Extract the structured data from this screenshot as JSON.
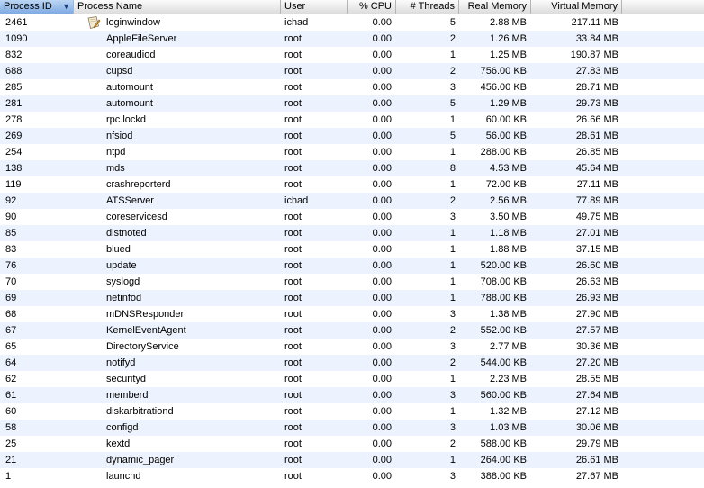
{
  "columns": {
    "pid": "Process ID",
    "name": "Process Name",
    "user": "User",
    "cpu": "% CPU",
    "threads": "# Threads",
    "real": "Real Memory",
    "virtual": "Virtual Memory"
  },
  "sort": {
    "column": "pid",
    "direction": "descending"
  },
  "rows": [
    {
      "pid": "2461",
      "name": "loginwindow",
      "user": "ichad",
      "cpu": "0.00",
      "threads": "5",
      "real": "2.88 MB",
      "virtual": "217.11 MB",
      "icon": "loginwindow-app-icon"
    },
    {
      "pid": "1090",
      "name": "AppleFileServer",
      "user": "root",
      "cpu": "0.00",
      "threads": "2",
      "real": "1.26 MB",
      "virtual": "33.84 MB"
    },
    {
      "pid": "832",
      "name": "coreaudiod",
      "user": "root",
      "cpu": "0.00",
      "threads": "1",
      "real": "1.25 MB",
      "virtual": "190.87 MB"
    },
    {
      "pid": "688",
      "name": "cupsd",
      "user": "root",
      "cpu": "0.00",
      "threads": "2",
      "real": "756.00 KB",
      "virtual": "27.83 MB"
    },
    {
      "pid": "285",
      "name": "automount",
      "user": "root",
      "cpu": "0.00",
      "threads": "3",
      "real": "456.00 KB",
      "virtual": "28.71 MB"
    },
    {
      "pid": "281",
      "name": "automount",
      "user": "root",
      "cpu": "0.00",
      "threads": "5",
      "real": "1.29 MB",
      "virtual": "29.73 MB"
    },
    {
      "pid": "278",
      "name": "rpc.lockd",
      "user": "root",
      "cpu": "0.00",
      "threads": "1",
      "real": "60.00 KB",
      "virtual": "26.66 MB"
    },
    {
      "pid": "269",
      "name": "nfsiod",
      "user": "root",
      "cpu": "0.00",
      "threads": "5",
      "real": "56.00 KB",
      "virtual": "28.61 MB"
    },
    {
      "pid": "254",
      "name": "ntpd",
      "user": "root",
      "cpu": "0.00",
      "threads": "1",
      "real": "288.00 KB",
      "virtual": "26.85 MB"
    },
    {
      "pid": "138",
      "name": "mds",
      "user": "root",
      "cpu": "0.00",
      "threads": "8",
      "real": "4.53 MB",
      "virtual": "45.64 MB"
    },
    {
      "pid": "119",
      "name": "crashreporterd",
      "user": "root",
      "cpu": "0.00",
      "threads": "1",
      "real": "72.00 KB",
      "virtual": "27.11 MB"
    },
    {
      "pid": "92",
      "name": "ATSServer",
      "user": "ichad",
      "cpu": "0.00",
      "threads": "2",
      "real": "2.56 MB",
      "virtual": "77.89 MB"
    },
    {
      "pid": "90",
      "name": "coreservicesd",
      "user": "root",
      "cpu": "0.00",
      "threads": "3",
      "real": "3.50 MB",
      "virtual": "49.75 MB"
    },
    {
      "pid": "85",
      "name": "distnoted",
      "user": "root",
      "cpu": "0.00",
      "threads": "1",
      "real": "1.18 MB",
      "virtual": "27.01 MB"
    },
    {
      "pid": "83",
      "name": "blued",
      "user": "root",
      "cpu": "0.00",
      "threads": "1",
      "real": "1.88 MB",
      "virtual": "37.15 MB"
    },
    {
      "pid": "76",
      "name": "update",
      "user": "root",
      "cpu": "0.00",
      "threads": "1",
      "real": "520.00 KB",
      "virtual": "26.60 MB"
    },
    {
      "pid": "70",
      "name": "syslogd",
      "user": "root",
      "cpu": "0.00",
      "threads": "1",
      "real": "708.00 KB",
      "virtual": "26.63 MB"
    },
    {
      "pid": "69",
      "name": "netinfod",
      "user": "root",
      "cpu": "0.00",
      "threads": "1",
      "real": "788.00 KB",
      "virtual": "26.93 MB"
    },
    {
      "pid": "68",
      "name": "mDNSResponder",
      "user": "root",
      "cpu": "0.00",
      "threads": "3",
      "real": "1.38 MB",
      "virtual": "27.90 MB"
    },
    {
      "pid": "67",
      "name": "KernelEventAgent",
      "user": "root",
      "cpu": "0.00",
      "threads": "2",
      "real": "552.00 KB",
      "virtual": "27.57 MB"
    },
    {
      "pid": "65",
      "name": "DirectoryService",
      "user": "root",
      "cpu": "0.00",
      "threads": "3",
      "real": "2.77 MB",
      "virtual": "30.36 MB"
    },
    {
      "pid": "64",
      "name": "notifyd",
      "user": "root",
      "cpu": "0.00",
      "threads": "2",
      "real": "544.00 KB",
      "virtual": "27.20 MB"
    },
    {
      "pid": "62",
      "name": "securityd",
      "user": "root",
      "cpu": "0.00",
      "threads": "1",
      "real": "2.23 MB",
      "virtual": "28.55 MB"
    },
    {
      "pid": "61",
      "name": "memberd",
      "user": "root",
      "cpu": "0.00",
      "threads": "3",
      "real": "560.00 KB",
      "virtual": "27.64 MB"
    },
    {
      "pid": "60",
      "name": "diskarbitrationd",
      "user": "root",
      "cpu": "0.00",
      "threads": "1",
      "real": "1.32 MB",
      "virtual": "27.12 MB"
    },
    {
      "pid": "58",
      "name": "configd",
      "user": "root",
      "cpu": "0.00",
      "threads": "3",
      "real": "1.03 MB",
      "virtual": "30.06 MB"
    },
    {
      "pid": "25",
      "name": "kextd",
      "user": "root",
      "cpu": "0.00",
      "threads": "2",
      "real": "588.00 KB",
      "virtual": "29.79 MB"
    },
    {
      "pid": "21",
      "name": "dynamic_pager",
      "user": "root",
      "cpu": "0.00",
      "threads": "1",
      "real": "264.00 KB",
      "virtual": "26.61 MB"
    },
    {
      "pid": "1",
      "name": "launchd",
      "user": "root",
      "cpu": "0.00",
      "threads": "3",
      "real": "388.00 KB",
      "virtual": "27.67 MB"
    }
  ]
}
